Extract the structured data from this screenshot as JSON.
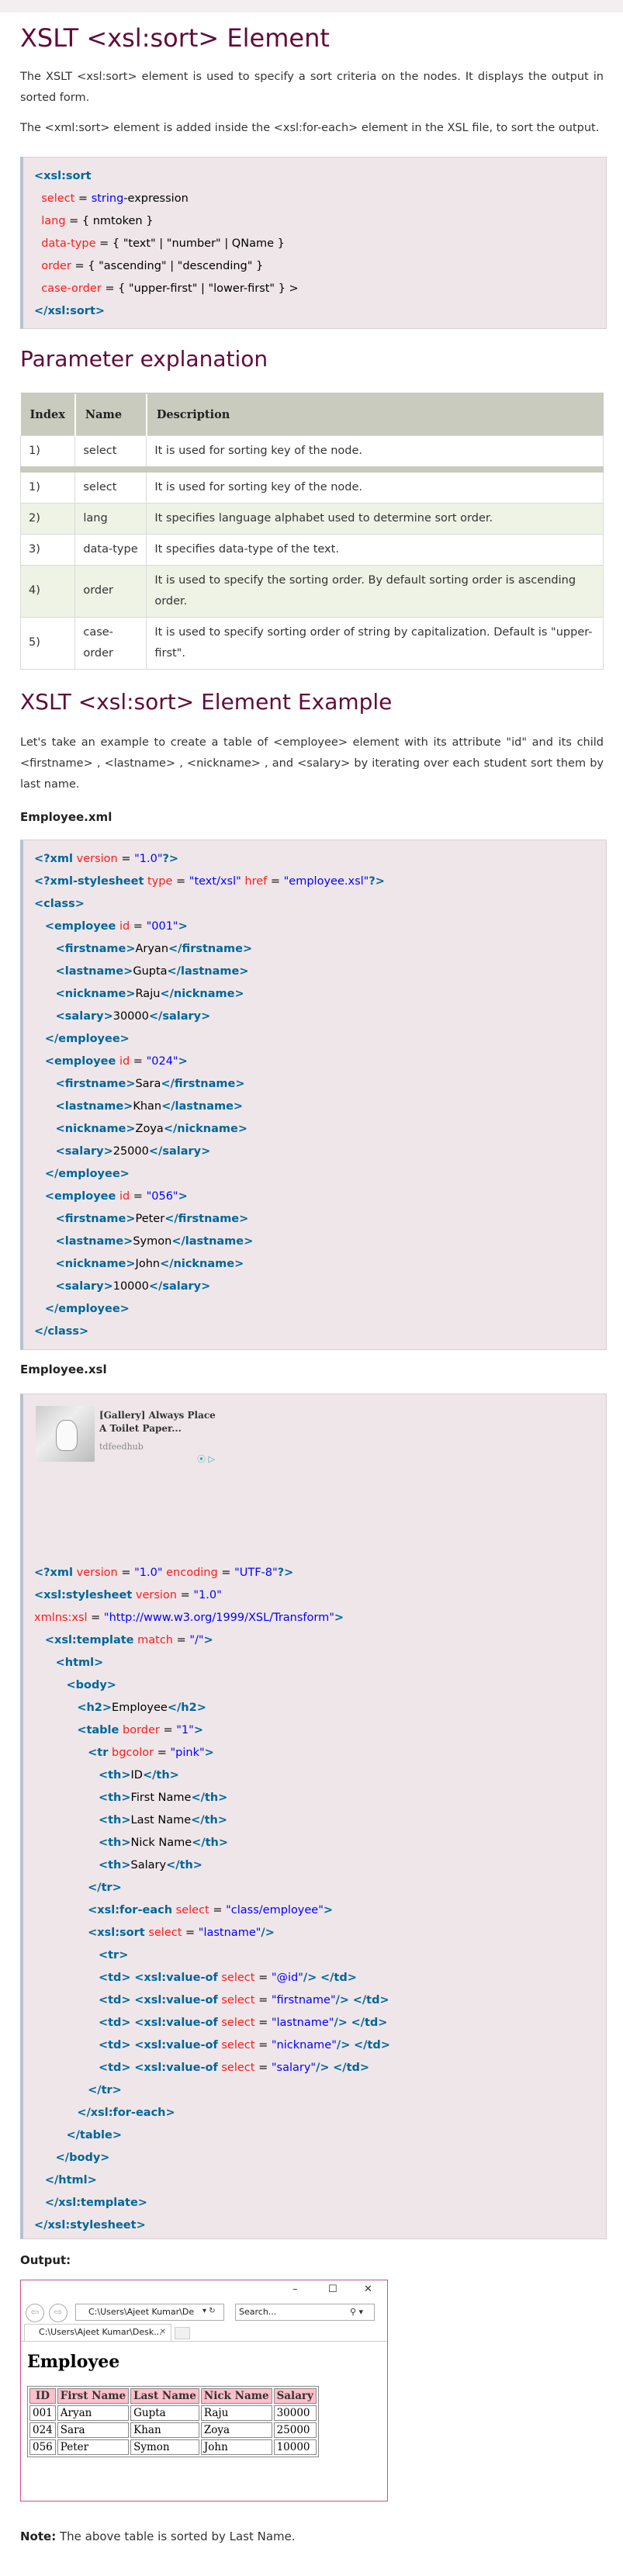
{
  "title": "XSLT <xsl:sort> Element",
  "intro": {
    "p1": "The XSLT <xsl:sort> element is used to specify a sort criteria on the nodes. It displays the output in sorted form.",
    "p2": "The <xml:sort> element is added inside the <xsl:for-each> element in the XSL file, to sort the output."
  },
  "syntax_lines": [
    [
      [
        "kw",
        "<xsl:sort"
      ]
    ],
    [
      [
        "tx",
        "  "
      ],
      [
        "at",
        "select"
      ],
      [
        "tx",
        " = "
      ],
      [
        "sv",
        "string"
      ],
      [
        "tx",
        "-expression"
      ]
    ],
    [
      [
        "tx",
        "  "
      ],
      [
        "at",
        "lang"
      ],
      [
        "tx",
        " = { nmtoken }"
      ]
    ],
    [
      [
        "tx",
        "  "
      ],
      [
        "at",
        "data-type"
      ],
      [
        "tx",
        " = { \"text\" | \"number\" | QName }"
      ]
    ],
    [
      [
        "tx",
        "  "
      ],
      [
        "at",
        "order"
      ],
      [
        "tx",
        " = { \"ascending\" | \"descending\" }"
      ]
    ],
    [
      [
        "tx",
        "  "
      ],
      [
        "at",
        "case-order"
      ],
      [
        "tx",
        " = { \"upper-first\" | \"lower-first\" } >"
      ]
    ],
    [
      [
        "kw",
        "</xsl:sort>"
      ]
    ]
  ],
  "param_heading": "Parameter explanation",
  "param_table": {
    "headers": [
      "Index",
      "Name",
      "Description"
    ],
    "rows": [
      [
        "1)",
        "select",
        "It is used for sorting key of the node."
      ],
      [
        "1)",
        "select",
        "It is used for sorting key of the node."
      ],
      [
        "2)",
        "lang",
        "It specifies language alphabet used to determine sort order."
      ],
      [
        "3)",
        "data-type",
        "It specifies data-type of the text."
      ],
      [
        "4)",
        "order",
        "It is used to specify the sorting order. By default sorting order is ascending order."
      ],
      [
        "5)",
        "case-order",
        "It is used to specify sorting order of string by capitalization. Default is \"upper-first\"."
      ]
    ]
  },
  "example_heading": "XSLT <xsl:sort> Element Example",
  "example_para": "Let's take an example to create a table of <employee> element with its attribute \"id\" and its child <firstname> , <lastname> , <nickname> , and <salary> by iterating over each student sort them by last name.",
  "employee_xml_label": "Employee.xml",
  "xml_lines": [
    [
      [
        "kw",
        "<?xml"
      ],
      [
        "tx",
        " "
      ],
      [
        "at",
        "version"
      ],
      [
        "tx",
        " = "
      ],
      [
        "sv",
        "\"1.0\""
      ],
      [
        "kw",
        "?>"
      ]
    ],
    [
      [
        "kw",
        "<?xml-stylesheet"
      ],
      [
        "tx",
        " "
      ],
      [
        "at",
        "type"
      ],
      [
        "tx",
        " = "
      ],
      [
        "sv",
        "\"text/xsl\""
      ],
      [
        "tx",
        " "
      ],
      [
        "at",
        "href"
      ],
      [
        "tx",
        " = "
      ],
      [
        "sv",
        "\"employee.xsl\""
      ],
      [
        "kw",
        "?>"
      ]
    ],
    [
      [
        "kw",
        "<class>"
      ]
    ],
    [
      [
        "tx",
        "   "
      ],
      [
        "kw",
        "<employee"
      ],
      [
        "tx",
        " "
      ],
      [
        "at",
        "id"
      ],
      [
        "tx",
        " = "
      ],
      [
        "sv",
        "\"001\""
      ],
      [
        "kw",
        ">"
      ]
    ],
    [
      [
        "tx",
        "      "
      ],
      [
        "kw",
        "<firstname>"
      ],
      [
        "tx",
        "Aryan"
      ],
      [
        "kw",
        "</firstname>"
      ]
    ],
    [
      [
        "tx",
        "      "
      ],
      [
        "kw",
        "<lastname>"
      ],
      [
        "tx",
        "Gupta"
      ],
      [
        "kw",
        "</lastname>"
      ]
    ],
    [
      [
        "tx",
        "      "
      ],
      [
        "kw",
        "<nickname>"
      ],
      [
        "tx",
        "Raju"
      ],
      [
        "kw",
        "</nickname>"
      ]
    ],
    [
      [
        "tx",
        "      "
      ],
      [
        "kw",
        "<salary>"
      ],
      [
        "tx",
        "30000"
      ],
      [
        "kw",
        "</salary>"
      ]
    ],
    [
      [
        "tx",
        "   "
      ],
      [
        "kw",
        "</employee>"
      ]
    ],
    [
      [
        "tx",
        "   "
      ],
      [
        "kw",
        "<employee"
      ],
      [
        "tx",
        " "
      ],
      [
        "at",
        "id"
      ],
      [
        "tx",
        " = "
      ],
      [
        "sv",
        "\"024\""
      ],
      [
        "kw",
        ">"
      ]
    ],
    [
      [
        "tx",
        "      "
      ],
      [
        "kw",
        "<firstname>"
      ],
      [
        "tx",
        "Sara"
      ],
      [
        "kw",
        "</firstname>"
      ]
    ],
    [
      [
        "tx",
        "      "
      ],
      [
        "kw",
        "<lastname>"
      ],
      [
        "tx",
        "Khan"
      ],
      [
        "kw",
        "</lastname>"
      ]
    ],
    [
      [
        "tx",
        "      "
      ],
      [
        "kw",
        "<nickname>"
      ],
      [
        "tx",
        "Zoya"
      ],
      [
        "kw",
        "</nickname>"
      ]
    ],
    [
      [
        "tx",
        "      "
      ],
      [
        "kw",
        "<salary>"
      ],
      [
        "tx",
        "25000"
      ],
      [
        "kw",
        "</salary>"
      ]
    ],
    [
      [
        "tx",
        "   "
      ],
      [
        "kw",
        "</employee>"
      ]
    ],
    [
      [
        "tx",
        "   "
      ],
      [
        "kw",
        "<employee"
      ],
      [
        "tx",
        " "
      ],
      [
        "at",
        "id"
      ],
      [
        "tx",
        " = "
      ],
      [
        "sv",
        "\"056\""
      ],
      [
        "kw",
        ">"
      ]
    ],
    [
      [
        "tx",
        "      "
      ],
      [
        "kw",
        "<firstname>"
      ],
      [
        "tx",
        "Peter"
      ],
      [
        "kw",
        "</firstname>"
      ]
    ],
    [
      [
        "tx",
        "      "
      ],
      [
        "kw",
        "<lastname>"
      ],
      [
        "tx",
        "Symon"
      ],
      [
        "kw",
        "</lastname>"
      ]
    ],
    [
      [
        "tx",
        "      "
      ],
      [
        "kw",
        "<nickname>"
      ],
      [
        "tx",
        "John"
      ],
      [
        "kw",
        "</nickname>"
      ]
    ],
    [
      [
        "tx",
        "      "
      ],
      [
        "kw",
        "<salary>"
      ],
      [
        "tx",
        "10000"
      ],
      [
        "kw",
        "</salary>"
      ]
    ],
    [
      [
        "tx",
        "   "
      ],
      [
        "kw",
        "</employee>"
      ]
    ],
    [
      [
        "kw",
        "</class>"
      ]
    ]
  ],
  "employee_xsl_label": "Employee.xsl",
  "ad": {
    "title": "[Gallery] Always Place A Toilet Paper...",
    "source": "tdfeedhub",
    "icons": "⦿ ▷"
  },
  "xsl_lines": [
    [
      [
        "kw",
        "<?xml"
      ],
      [
        "tx",
        " "
      ],
      [
        "at",
        "version"
      ],
      [
        "tx",
        " = "
      ],
      [
        "sv",
        "\"1.0\""
      ],
      [
        "tx",
        " "
      ],
      [
        "at",
        "encoding"
      ],
      [
        "tx",
        " = "
      ],
      [
        "sv",
        "\"UTF-8\""
      ],
      [
        "kw",
        "?>"
      ]
    ],
    [
      [
        "kw",
        "<xsl:stylesheet"
      ],
      [
        "tx",
        " "
      ],
      [
        "at",
        "version"
      ],
      [
        "tx",
        " = "
      ],
      [
        "sv",
        "\"1.0\""
      ]
    ],
    [
      [
        "at",
        "xmlns:xsl"
      ],
      [
        "tx",
        " = "
      ],
      [
        "sv",
        "\"http://www.w3.org/1999/XSL/Transform\""
      ],
      [
        "kw",
        ">"
      ]
    ],
    [
      [
        "tx",
        "   "
      ],
      [
        "kw",
        "<xsl:template"
      ],
      [
        "tx",
        " "
      ],
      [
        "at",
        "match"
      ],
      [
        "tx",
        " = "
      ],
      [
        "sv",
        "\"/\""
      ],
      [
        "kw",
        ">"
      ]
    ],
    [
      [
        "tx",
        "      "
      ],
      [
        "kw",
        "<html>"
      ]
    ],
    [
      [
        "tx",
        "         "
      ],
      [
        "kw",
        "<body>"
      ]
    ],
    [
      [
        "tx",
        "            "
      ],
      [
        "kw",
        "<h2>"
      ],
      [
        "tx",
        "Employee"
      ],
      [
        "kw",
        "</h2>"
      ]
    ],
    [
      [
        "tx",
        "            "
      ],
      [
        "kw",
        "<table"
      ],
      [
        "tx",
        " "
      ],
      [
        "at",
        "border"
      ],
      [
        "tx",
        " = "
      ],
      [
        "sv",
        "\"1\""
      ],
      [
        "kw",
        ">"
      ]
    ],
    [
      [
        "tx",
        "               "
      ],
      [
        "kw",
        "<tr"
      ],
      [
        "tx",
        " "
      ],
      [
        "at",
        "bgcolor"
      ],
      [
        "tx",
        " = "
      ],
      [
        "sv",
        "\"pink\""
      ],
      [
        "kw",
        ">"
      ]
    ],
    [
      [
        "tx",
        "                  "
      ],
      [
        "kw",
        "<th>"
      ],
      [
        "tx",
        "ID"
      ],
      [
        "kw",
        "</th>"
      ]
    ],
    [
      [
        "tx",
        "                  "
      ],
      [
        "kw",
        "<th>"
      ],
      [
        "tx",
        "First Name"
      ],
      [
        "kw",
        "</th>"
      ]
    ],
    [
      [
        "tx",
        "                  "
      ],
      [
        "kw",
        "<th>"
      ],
      [
        "tx",
        "Last Name"
      ],
      [
        "kw",
        "</th>"
      ]
    ],
    [
      [
        "tx",
        "                  "
      ],
      [
        "kw",
        "<th>"
      ],
      [
        "tx",
        "Nick Name"
      ],
      [
        "kw",
        "</th>"
      ]
    ],
    [
      [
        "tx",
        "                  "
      ],
      [
        "kw",
        "<th>"
      ],
      [
        "tx",
        "Salary"
      ],
      [
        "kw",
        "</th>"
      ]
    ],
    [
      [
        "tx",
        "               "
      ],
      [
        "kw",
        "</tr>"
      ]
    ],
    [
      [
        "tx",
        "               "
      ],
      [
        "kw",
        "<xsl:for-each"
      ],
      [
        "tx",
        " "
      ],
      [
        "at",
        "select"
      ],
      [
        "tx",
        " = "
      ],
      [
        "sv",
        "\"class/employee\""
      ],
      [
        "kw",
        ">"
      ]
    ],
    [
      [
        "tx",
        "               "
      ],
      [
        "kw",
        "<xsl:sort"
      ],
      [
        "tx",
        " "
      ],
      [
        "at",
        "select"
      ],
      [
        "tx",
        " = "
      ],
      [
        "sv",
        "\"lastname\""
      ],
      [
        "kw",
        "/>"
      ]
    ],
    [
      [
        "tx",
        "                  "
      ],
      [
        "kw",
        "<tr>"
      ]
    ],
    [
      [
        "tx",
        "                  "
      ],
      [
        "kw",
        "<td>"
      ],
      [
        "tx",
        " "
      ],
      [
        "kw",
        "<xsl:value-of"
      ],
      [
        "tx",
        " "
      ],
      [
        "at",
        "select"
      ],
      [
        "tx",
        " = "
      ],
      [
        "sv",
        "\"@id\""
      ],
      [
        "kw",
        "/>"
      ],
      [
        "tx",
        " "
      ],
      [
        "kw",
        "</td>"
      ]
    ],
    [
      [
        "tx",
        "                  "
      ],
      [
        "kw",
        "<td>"
      ],
      [
        "tx",
        " "
      ],
      [
        "kw",
        "<xsl:value-of"
      ],
      [
        "tx",
        " "
      ],
      [
        "at",
        "select"
      ],
      [
        "tx",
        " = "
      ],
      [
        "sv",
        "\"firstname\""
      ],
      [
        "kw",
        "/>"
      ],
      [
        "tx",
        " "
      ],
      [
        "kw",
        "</td>"
      ]
    ],
    [
      [
        "tx",
        "                  "
      ],
      [
        "kw",
        "<td>"
      ],
      [
        "tx",
        " "
      ],
      [
        "kw",
        "<xsl:value-of"
      ],
      [
        "tx",
        " "
      ],
      [
        "at",
        "select"
      ],
      [
        "tx",
        " = "
      ],
      [
        "sv",
        "\"lastname\""
      ],
      [
        "kw",
        "/>"
      ],
      [
        "tx",
        " "
      ],
      [
        "kw",
        "</td>"
      ]
    ],
    [
      [
        "tx",
        "                  "
      ],
      [
        "kw",
        "<td>"
      ],
      [
        "tx",
        " "
      ],
      [
        "kw",
        "<xsl:value-of"
      ],
      [
        "tx",
        " "
      ],
      [
        "at",
        "select"
      ],
      [
        "tx",
        " = "
      ],
      [
        "sv",
        "\"nickname\""
      ],
      [
        "kw",
        "/>"
      ],
      [
        "tx",
        " "
      ],
      [
        "kw",
        "</td>"
      ]
    ],
    [
      [
        "tx",
        "                  "
      ],
      [
        "kw",
        "<td>"
      ],
      [
        "tx",
        " "
      ],
      [
        "kw",
        "<xsl:value-of"
      ],
      [
        "tx",
        " "
      ],
      [
        "at",
        "select"
      ],
      [
        "tx",
        " = "
      ],
      [
        "sv",
        "\"salary\""
      ],
      [
        "kw",
        "/>"
      ],
      [
        "tx",
        " "
      ],
      [
        "kw",
        "</td>"
      ]
    ],
    [
      [
        "tx",
        "               "
      ],
      [
        "kw",
        "</tr>"
      ]
    ],
    [
      [
        "tx",
        "            "
      ],
      [
        "kw",
        "</xsl:for-each>"
      ]
    ],
    [
      [
        "tx",
        "         "
      ],
      [
        "kw",
        "</table>"
      ]
    ],
    [
      [
        "tx",
        "      "
      ],
      [
        "kw",
        "</body>"
      ]
    ],
    [
      [
        "tx",
        "   "
      ],
      [
        "kw",
        "</html>"
      ]
    ],
    [
      [
        "tx",
        "   "
      ],
      [
        "kw",
        "</xsl:template>"
      ]
    ],
    [
      [
        "kw",
        "</xsl:stylesheet>"
      ]
    ]
  ],
  "output_label": "Output:",
  "browser": {
    "minimize": "–",
    "maximize": "☐",
    "close": "✕",
    "back": "⇦",
    "forward": "⇨",
    "address": "C:\\Users\\Ajeet Kumar\\De",
    "address_icons": "▾ ↻",
    "search_placeholder": "Search...",
    "search_icon": "⚲ ▾",
    "tab_label": "C:\\Users\\Ajeet Kumar\\Desk...",
    "tab_close": "✕",
    "page_heading": "Employee",
    "table_headers": [
      "ID",
      "First Name",
      "Last Name",
      "Nick Name",
      "Salary"
    ],
    "table_rows": [
      [
        "001",
        "Aryan",
        "Gupta",
        "Raju",
        "30000"
      ],
      [
        "024",
        "Sara",
        "Khan",
        "Zoya",
        "25000"
      ],
      [
        "056",
        "Peter",
        "Symon",
        "John",
        "10000"
      ]
    ]
  },
  "note": {
    "label": "Note:",
    "text": " The above table is sorted by Last Name."
  },
  "colors": {
    "heading": "#610b38",
    "code_bg": "#efe6e9",
    "keyword": "#006699",
    "attribute": "#ff1a1a",
    "string": "#0000ff",
    "table_header": "#c8cbbd",
    "table_alt_row": "#eef3e6",
    "browser_border": "#d54b8c",
    "pink": "#ffc0cb"
  }
}
